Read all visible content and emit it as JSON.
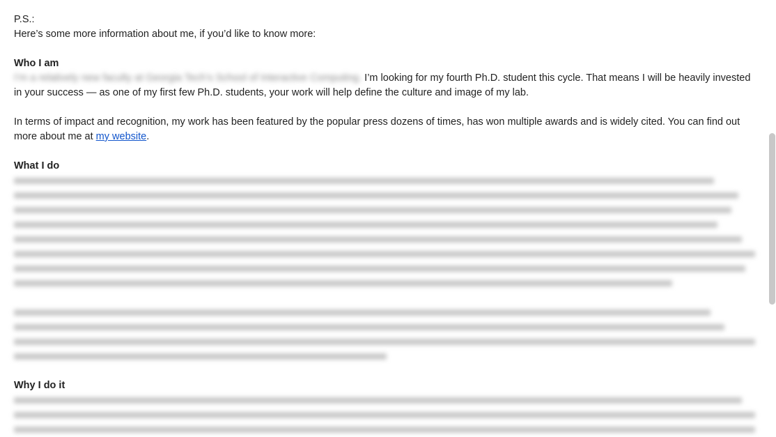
{
  "email": {
    "ps_label": "P.S.:",
    "intro": "Here’s some more information about me, if you’d like to know more:",
    "who_heading": "Who I am",
    "who_redacted": "I’m a relatively new faculty at Georgia Tech’s School of Interactive Computing.",
    "who_text": " I’m looking for my fourth Ph.D. student this cycle. That means I will be heavily invested in your success — as one of my first few Ph.D. students, your work will help define the culture and image of my lab.",
    "impact_text": "In terms of impact and recognition, my work has been featured by the popular press dozens of times, has won multiple awards and is widely cited. You can find out more about me at ",
    "website_link": "my website",
    "period": ".",
    "what_heading": "What I do",
    "why_heading": "Why I do it"
  }
}
